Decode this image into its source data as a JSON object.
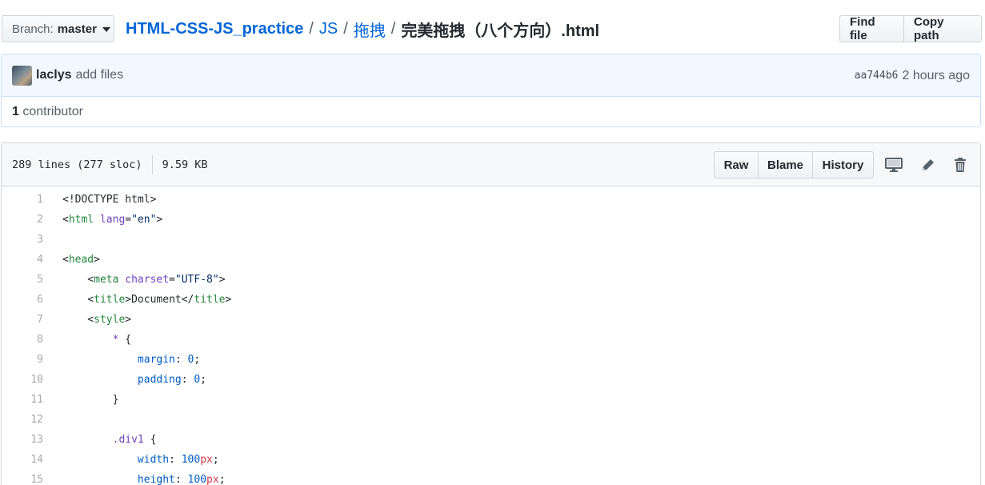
{
  "branch": {
    "label": "Branch:",
    "value": "master"
  },
  "breadcrumb": {
    "repo": "HTML-CSS-JS_practice",
    "sep": "/",
    "dir1": "JS",
    "dir2": "拖拽",
    "file": "完美拖拽（八个方向）.html"
  },
  "header_buttons": {
    "find_file": "Find file",
    "copy_path": "Copy path"
  },
  "commit": {
    "author": "laclys",
    "message": "add files",
    "sha": "aa744b6",
    "time": "2 hours ago",
    "contributors_count": "1",
    "contributors_label": "contributor"
  },
  "file": {
    "lines_info": "289 lines (277 sloc)",
    "size": "9.59 KB",
    "buttons": {
      "raw": "Raw",
      "blame": "Blame",
      "history": "History"
    },
    "icons": [
      "desktop-icon",
      "pencil-icon",
      "trash-icon"
    ]
  },
  "code": [
    {
      "n": "1",
      "tokens": [
        {
          "t": "<!DOCTYPE html>",
          "c": ""
        }
      ]
    },
    {
      "n": "2",
      "tokens": [
        {
          "t": "<",
          "c": ""
        },
        {
          "t": "html",
          "c": "tag"
        },
        {
          "t": " ",
          "c": ""
        },
        {
          "t": "lang",
          "c": "attr"
        },
        {
          "t": "=",
          "c": ""
        },
        {
          "t": "\"en\"",
          "c": "str"
        },
        {
          "t": ">",
          "c": ""
        }
      ]
    },
    {
      "n": "3",
      "tokens": []
    },
    {
      "n": "4",
      "tokens": [
        {
          "t": "<",
          "c": ""
        },
        {
          "t": "head",
          "c": "tag"
        },
        {
          "t": ">",
          "c": ""
        }
      ]
    },
    {
      "n": "5",
      "tokens": [
        {
          "t": "    <",
          "c": ""
        },
        {
          "t": "meta",
          "c": "tag"
        },
        {
          "t": " ",
          "c": ""
        },
        {
          "t": "charset",
          "c": "attr"
        },
        {
          "t": "=",
          "c": ""
        },
        {
          "t": "\"UTF-8\"",
          "c": "str"
        },
        {
          "t": ">",
          "c": ""
        }
      ]
    },
    {
      "n": "6",
      "tokens": [
        {
          "t": "    <",
          "c": ""
        },
        {
          "t": "title",
          "c": "tag"
        },
        {
          "t": ">Document</",
          "c": ""
        },
        {
          "t": "title",
          "c": "tag"
        },
        {
          "t": ">",
          "c": ""
        }
      ]
    },
    {
      "n": "7",
      "tokens": [
        {
          "t": "    <",
          "c": ""
        },
        {
          "t": "style",
          "c": "tag"
        },
        {
          "t": ">",
          "c": ""
        }
      ]
    },
    {
      "n": "8",
      "tokens": [
        {
          "t": "        ",
          "c": ""
        },
        {
          "t": "*",
          "c": "sel"
        },
        {
          "t": " {",
          "c": ""
        }
      ]
    },
    {
      "n": "9",
      "tokens": [
        {
          "t": "            ",
          "c": ""
        },
        {
          "t": "margin",
          "c": "prop"
        },
        {
          "t": ": ",
          "c": ""
        },
        {
          "t": "0",
          "c": "num"
        },
        {
          "t": ";",
          "c": ""
        }
      ]
    },
    {
      "n": "10",
      "tokens": [
        {
          "t": "            ",
          "c": ""
        },
        {
          "t": "padding",
          "c": "prop"
        },
        {
          "t": ": ",
          "c": ""
        },
        {
          "t": "0",
          "c": "num"
        },
        {
          "t": ";",
          "c": ""
        }
      ]
    },
    {
      "n": "11",
      "tokens": [
        {
          "t": "        }",
          "c": ""
        }
      ]
    },
    {
      "n": "12",
      "tokens": []
    },
    {
      "n": "13",
      "tokens": [
        {
          "t": "        ",
          "c": ""
        },
        {
          "t": ".div1",
          "c": "sel"
        },
        {
          "t": " {",
          "c": ""
        }
      ]
    },
    {
      "n": "14",
      "tokens": [
        {
          "t": "            ",
          "c": ""
        },
        {
          "t": "width",
          "c": "prop"
        },
        {
          "t": ": ",
          "c": ""
        },
        {
          "t": "100",
          "c": "num"
        },
        {
          "t": "px",
          "c": "unit"
        },
        {
          "t": ";",
          "c": ""
        }
      ]
    },
    {
      "n": "15",
      "tokens": [
        {
          "t": "            ",
          "c": ""
        },
        {
          "t": "height",
          "c": "prop"
        },
        {
          "t": ": ",
          "c": ""
        },
        {
          "t": "100",
          "c": "num"
        },
        {
          "t": "px",
          "c": "unit"
        },
        {
          "t": ";",
          "c": ""
        }
      ]
    }
  ]
}
